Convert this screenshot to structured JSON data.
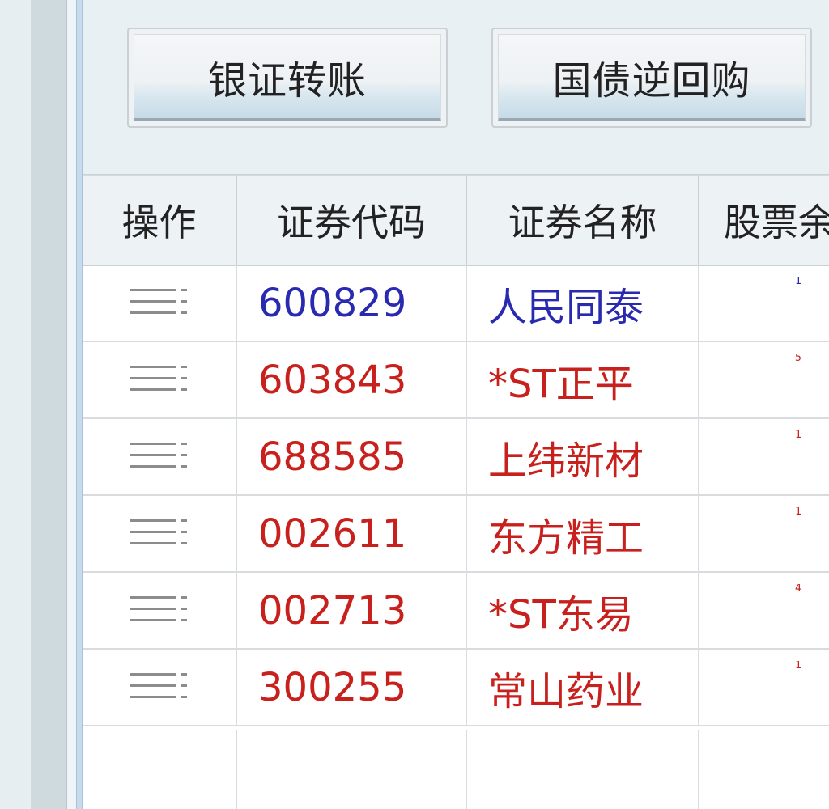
{
  "toolbar": {
    "bank_transfer_label": "银证转账",
    "reverse_repo_label": "国债逆回购"
  },
  "table": {
    "headers": [
      "操作",
      "证券代码",
      "证券名称",
      "股票余"
    ],
    "rows": [
      {
        "code": "600829",
        "name": "人民同泰",
        "color": "#2a2ab0",
        "partial": "1",
        "icon": "menu-lines-icon"
      },
      {
        "code": "603843",
        "name": "*ST正平",
        "color": "#c8201c",
        "partial": "5",
        "icon": "menu-lines-icon"
      },
      {
        "code": "688585",
        "name": "上纬新材",
        "color": "#c8201c",
        "partial": "1",
        "icon": "menu-lines-icon"
      },
      {
        "code": "002611",
        "name": "东方精工",
        "color": "#c8201c",
        "partial": "1",
        "icon": "menu-lines-icon"
      },
      {
        "code": "002713",
        "name": "*ST东易",
        "color": "#c8201c",
        "partial": "4",
        "icon": "menu-lines-icon"
      },
      {
        "code": "300255",
        "name": "常山药业",
        "color": "#c8201c",
        "partial": "1",
        "icon": "menu-lines-icon"
      }
    ]
  }
}
